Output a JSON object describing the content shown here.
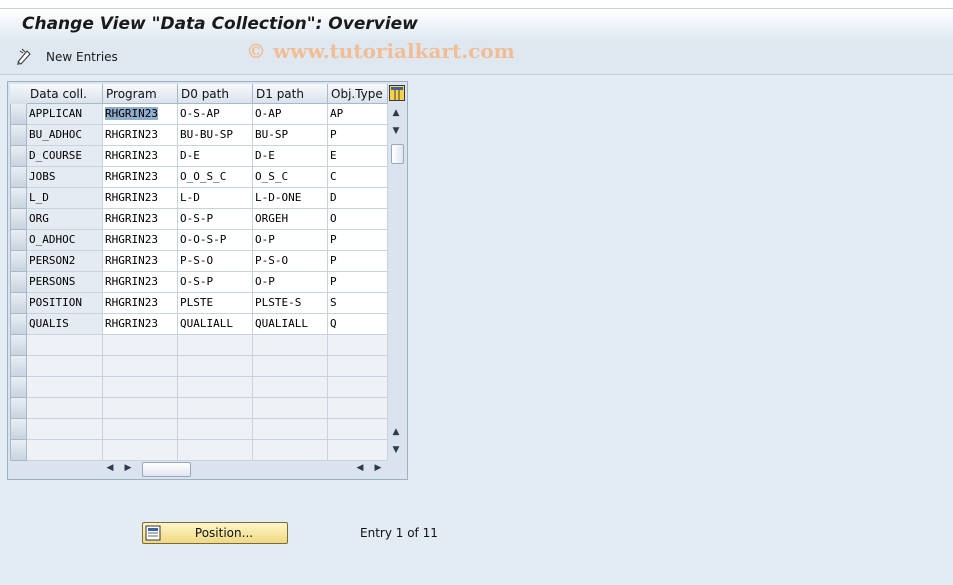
{
  "title": "Change View \"Data Collection\": Overview",
  "toolbar": {
    "new_entries_label": "New Entries",
    "new_entries_icon": "pencil-icon"
  },
  "watermark": "© www.tutorialkart.com",
  "table": {
    "columns": [
      "Data coll.",
      "Program",
      "D0 path",
      "D1 path",
      "Obj.Type"
    ],
    "rows": [
      [
        "APPLICAN",
        "RHGRIN23",
        "O-S-AP",
        "O-AP",
        "AP"
      ],
      [
        "BU_ADHOC",
        "RHGRIN23",
        "BU-BU-SP",
        "BU-SP",
        "P"
      ],
      [
        "D_COURSE",
        "RHGRIN23",
        "D-E",
        "D-E",
        "E"
      ],
      [
        "JOBS",
        "RHGRIN23",
        "O_O_S_C",
        "O_S_C",
        "C"
      ],
      [
        "L_D",
        "RHGRIN23",
        "L-D",
        "L-D-ONE",
        "D"
      ],
      [
        "ORG",
        "RHGRIN23",
        "O-S-P",
        "ORGEH",
        "O"
      ],
      [
        "O_ADHOC",
        "RHGRIN23",
        "O-O-S-P",
        "O-P",
        "P"
      ],
      [
        "PERSON2",
        "RHGRIN23",
        "P-S-O",
        "P-S-O",
        "P"
      ],
      [
        "PERSONS",
        "RHGRIN23",
        "O-S-P",
        "O-P",
        "P"
      ],
      [
        "POSITION",
        "RHGRIN23",
        "PLSTE",
        "PLSTE-S",
        "S"
      ],
      [
        "QUALIS",
        "RHGRIN23",
        "QUALIALL",
        "QUALIALL",
        "Q"
      ]
    ],
    "empty_rows": 6,
    "selected_cell": "RHGRIN23"
  },
  "footer": {
    "position_button_label": "Position...",
    "entry_text": "Entry 1 of 11"
  },
  "colors": {
    "selection": "#8faecd",
    "button_yellow": "#f0d982",
    "background": "#e3ebf4"
  }
}
